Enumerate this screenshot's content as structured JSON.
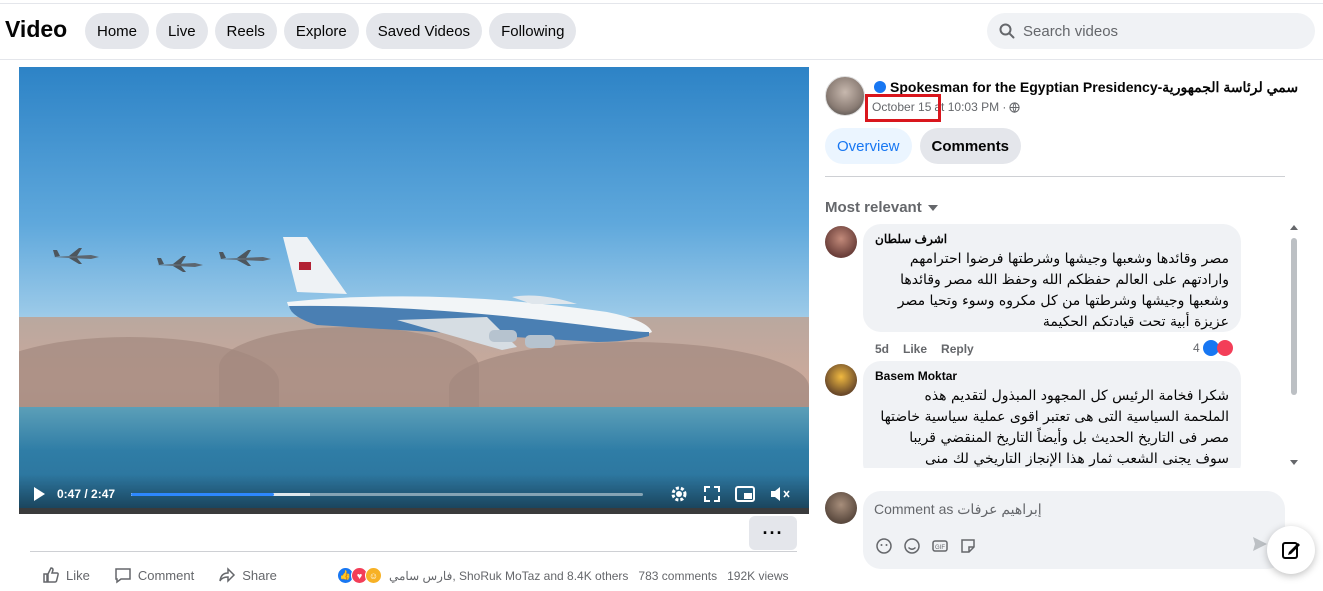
{
  "header": {
    "title": "Video",
    "nav": [
      "Home",
      "Live",
      "Reels",
      "Explore",
      "Saved Videos",
      "Following"
    ],
    "search_placeholder": "Search videos"
  },
  "player": {
    "current_time": "0:47",
    "duration": "2:47",
    "time_display": "0:47 / 2:47",
    "progress_fraction": 0.28
  },
  "actions": {
    "like": "Like",
    "comment": "Comment",
    "share": "Share",
    "more": "···"
  },
  "stats": {
    "reactors": "فارس سامي, ShoRuk MoTaz and 8.4K others",
    "comments": "783 comments",
    "views": "192K views"
  },
  "post": {
    "page_name": "Spokesman for the Egyptian Presidency-سمي لرئاسة الجمهورية",
    "date": "October 15",
    "time": "at 10:03 PM ·",
    "tabs": [
      "Overview",
      "Comments"
    ],
    "sort_label": "Most relevant"
  },
  "comments": [
    {
      "author": "اشرف سلطان",
      "text": "مصر وقائدها وشعبها وجيشها وشرطتها فرضوا احترامهم وارادتهم على العالم حفظكم الله وحفظ الله مصر وقائدها وشعبها وجيشها وشرطتها من كل مكروه وسوء وتحيا مصر عزيزة أبية تحت قيادتكم الحكيمة",
      "age": "5d",
      "like": "Like",
      "reply": "Reply",
      "reactions": "4"
    },
    {
      "author": "Basem Moktar",
      "text": "شكرا فخامة الرئيس كل المجهود المبذول لتقديم هذه الملحمة السياسية التى هى تعتبر اقوى عملية سياسية خاضتها مصر فى التاريخ الحديث بل وأيضاً التاريخ المنقضي قريبا سوف يجنى الشعب ثمار هذا الإنجاز التاريخي لك منى"
    }
  ],
  "composer": {
    "placeholder": "Comment as إبراهيم عرفات"
  },
  "colors": {
    "accent": "#1877f2",
    "highlight_box": "#d9161d",
    "pill_bg": "#e4e6eb"
  }
}
